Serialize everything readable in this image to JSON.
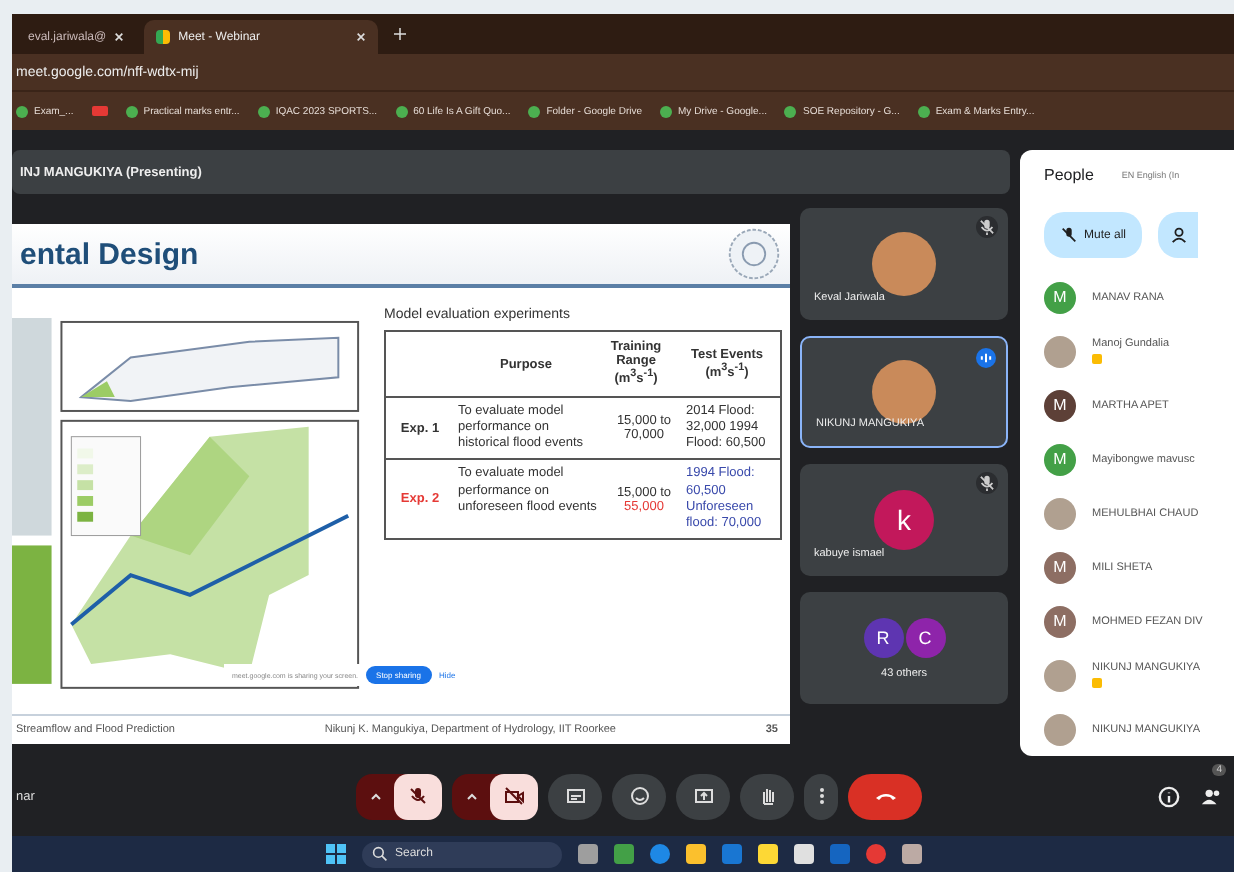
{
  "browser": {
    "tabs": [
      {
        "label": "eval.jariwala@",
        "selected": false
      },
      {
        "label": "Meet - Webinar",
        "selected": true
      }
    ],
    "url": "meet.google.com/nff-wdtx-mij",
    "bookmarks": [
      {
        "kind": "link",
        "label": "Exam_..."
      },
      {
        "kind": "video"
      },
      {
        "kind": "link",
        "label": "Practical marks entr..."
      },
      {
        "kind": "link",
        "label": "IQAC 2023 SPORTS..."
      },
      {
        "kind": "link",
        "label": "60 Life Is A Gift Quo..."
      },
      {
        "kind": "link",
        "label": "Folder - Google Drive"
      },
      {
        "kind": "link",
        "label": "My Drive - Google..."
      },
      {
        "kind": "link",
        "label": "SOE Repository - G..."
      },
      {
        "kind": "link",
        "label": "Exam & Marks Entry..."
      }
    ]
  },
  "presenting_bar": "INJ MANGUKIYA (Presenting)",
  "slide": {
    "title": "ental Design",
    "subtitle": "Model evaluation experiments",
    "headers": [
      "Purpose",
      "Training Range (m$^{3}$s$^{-1}$)",
      "Test Events (m$^{3}$s$^{-1}$)"
    ],
    "rows": [
      {
        "label": "Exp. 1",
        "highlight": false,
        "purpose": "To evaluate model performance on historical flood events",
        "range": [
          "15,000 to",
          "70,000"
        ],
        "events": "2014 Flood: 32,000 1994 Flood: 60,500"
      },
      {
        "label": "Exp. 2",
        "highlight": true,
        "purpose": "To evaluate model performance on unforeseen flood events",
        "range": [
          "15,000 to",
          "55,000"
        ],
        "events": "1994 Flood: 60,500 Unforeseen flood: 70,000"
      }
    ],
    "sharing_notice": "meet.google.com is sharing your screen.",
    "stop_button": "Stop sharing",
    "hide_button": "Hide",
    "footer_left": "Streamflow and Flood Prediction",
    "footer_center": "Nikunj K. Mangukiya, Department of Hydrology, IIT Roorkee",
    "page": "35"
  },
  "tiles": [
    {
      "kind": "photo",
      "name": "Keval Jariwala",
      "muted": true,
      "speaking": false
    },
    {
      "kind": "photo",
      "name": "NIKUNJ MANGUKIYA",
      "muted": false,
      "speaking": true
    },
    {
      "kind": "letter",
      "letter": "k",
      "color": "#c2185b",
      "name": "kabuye ismael",
      "muted": true,
      "speaking": false
    },
    {
      "kind": "others",
      "letters": [
        {
          "letter": "R",
          "color": "#5e35b1"
        },
        {
          "letter": "C",
          "color": "#8e24aa"
        }
      ],
      "name": "43 others"
    }
  ],
  "people": {
    "title": "People",
    "language": "EN English (In",
    "mute_all": "Mute all",
    "items": [
      {
        "kind": "letter",
        "letter": "M",
        "color": "#43a047",
        "name": "MANAV RANA",
        "badge": false
      },
      {
        "kind": "photo",
        "name": "Manoj Gundalia",
        "badge": true
      },
      {
        "kind": "letter",
        "letter": "M",
        "color": "#5d4037",
        "name": "MARTHA APET",
        "badge": false
      },
      {
        "kind": "letter",
        "letter": "M",
        "color": "#43a047",
        "name": "Mayibongwe mavusc",
        "badge": false
      },
      {
        "kind": "photo",
        "name": "MEHULBHAI CHAUD",
        "badge": false
      },
      {
        "kind": "letter",
        "letter": "M",
        "color": "#8d6e63",
        "name": "MILI SHETA",
        "badge": false
      },
      {
        "kind": "letter",
        "letter": "M",
        "color": "#8d6e63",
        "name": "MOHMED FEZAN DIV",
        "badge": false
      },
      {
        "kind": "photo",
        "name": "NIKUNJ MANGUKIYA",
        "badge": true
      },
      {
        "kind": "photo",
        "name": "NIKUNJ MANGUKIYA",
        "badge": false
      }
    ]
  },
  "meeting_name": "nar",
  "people_count": "4",
  "taskbar": {
    "search": "Search"
  }
}
